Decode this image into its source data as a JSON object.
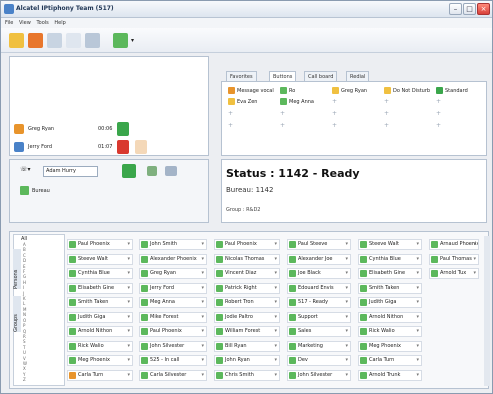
{
  "window": {
    "title": "Alcatel IPtiphony Team (517)"
  },
  "menu": [
    "File",
    "View",
    "Tools",
    "Help"
  ],
  "calls": [
    {
      "name": "Greg Ryan",
      "time": "00:06"
    },
    {
      "name": "Jerry Ford",
      "time": "01:07"
    }
  ],
  "tabs": [
    "Favorites",
    "Buttons",
    "Call board",
    "Redial"
  ],
  "buttons": [
    [
      "Message vocal",
      "Ro",
      "Greg Ryan",
      "Do Not Disturb",
      "Standard"
    ],
    [
      "Eva Zen",
      "Meg Anna",
      "",
      "",
      ""
    ]
  ],
  "search": {
    "value": "Adam Hurry",
    "bureau_label": "Bureau"
  },
  "status": {
    "title": "Status : 1142 - Ready",
    "bureau": "Bureau: 1142",
    "group": "Group : R&D2"
  },
  "sidebar": {
    "all": "All",
    "groups_tab": "Groups",
    "persons_tab": "Persons",
    "letters": [
      "A",
      "B",
      "C",
      "D",
      "E",
      "F",
      "G",
      "H",
      "I",
      "J",
      "K",
      "L",
      "M",
      "N",
      "O",
      "P",
      "Q",
      "R",
      "S",
      "T",
      "U",
      "V",
      "W",
      "X",
      "Y",
      "Z"
    ]
  },
  "directory": [
    [
      "Paul Phoenix",
      "Steeve Walt",
      "Cynthia Blue",
      "Elisabeth Gine",
      "Smith Taken",
      "Judith Giga",
      "Arnold Nithon",
      "Rick Walio",
      "Meg Phoenix",
      "Carla Turn"
    ],
    [
      "John Smith",
      "Alexander Phoenix",
      "Greg Ryan",
      "Jerry Ford",
      "Meg Anna",
      "Mike Forest",
      "Paul Phoenix",
      "John Silvester",
      "525 - In call",
      "Carla Silvester"
    ],
    [
      "Paul Phoenix",
      "Nicolas Thomas",
      "Vincent Diaz",
      "Patrick Right",
      "Robert Tron",
      "Jodie Paltro",
      "William Forest",
      "Bill Ryan",
      "John Ryan",
      "Chris Smith"
    ],
    [
      "Paul Steeve",
      "Alexander Joe",
      "Joe Black",
      "Edouard Envis",
      "517 - Ready",
      "Support",
      "Sales",
      "Marketing",
      "Dev",
      "John Silvester"
    ],
    [
      "Steeve Walt",
      "Cynthia Blue",
      "Elisabeth Gine",
      "Smith Taken",
      "Judith Giga",
      "Arnold Nithon",
      "Rick Walio",
      "Meg Phoenix",
      "Carla Turn",
      "Arnold Trunk"
    ],
    [
      "Arnaud Phoenix",
      "Paul Thomas",
      "Arnold Tux"
    ]
  ]
}
